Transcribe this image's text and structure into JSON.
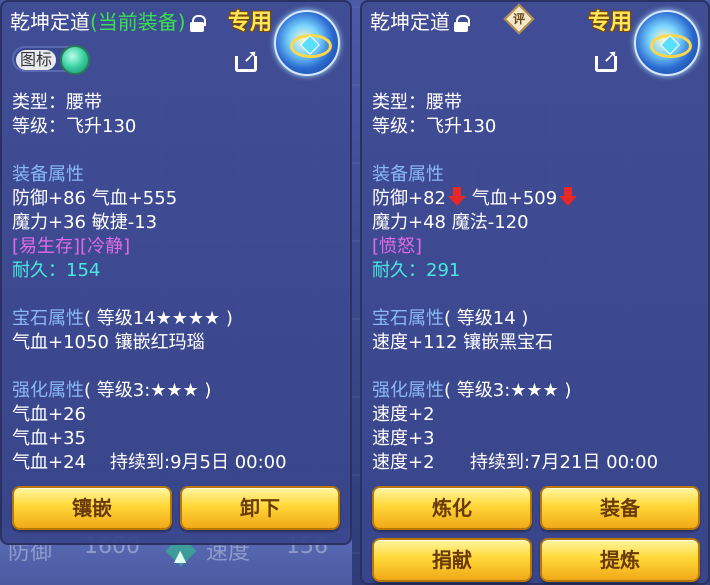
{
  "background": {
    "footer_left_label": "防御",
    "footer_left_value": "1600",
    "footer_right_label": "速度",
    "footer_right_value": "156"
  },
  "left": {
    "title_name": "乾坤定道",
    "title_equipped": "(当前装备)",
    "exclusive": "专用",
    "icon_toggle_label": "图标",
    "type": "类型：腰带",
    "level": "等级：飞升130",
    "attr_header": "装备属性",
    "attr_line1": "防御+86 气血+555",
    "attr_line2": "魔力+36 敏捷-13",
    "special": "[易生存][冷静]",
    "durability_label": "耐久：",
    "durability_value": "154",
    "gem_header": "宝石属性",
    "gem_level": "( 等级14★★★★ )",
    "gem_line": "气血+1050 镶嵌红玛瑙",
    "enhance_header": "强化属性",
    "enhance_level": "( 等级3:★★★ )",
    "enhance_lines": [
      "气血+26",
      "气血+35",
      "气血+24"
    ],
    "duration": "持续到:9月5日 00:00",
    "buttons": [
      "镶嵌",
      "卸下"
    ]
  },
  "right": {
    "title_name": "乾坤定道",
    "review": "评",
    "exclusive": "专用",
    "type": "类型：腰带",
    "level": "等级：飞升130",
    "attr_header": "装备属性",
    "attr_line1_a": "防御+82",
    "attr_line1_b": "气血+509",
    "attr_line2": "魔力+48 魔法-120",
    "special": "[愤怒]",
    "durability_label": "耐久：",
    "durability_value": "291",
    "gem_header": "宝石属性",
    "gem_level": "( 等级14 )",
    "gem_line": "速度+112 镶嵌黑宝石",
    "enhance_header": "强化属性",
    "enhance_level": "( 等级3:★★★ )",
    "enhance_lines": [
      "速度+2",
      "速度+3",
      "速度+2"
    ],
    "duration": "持续到:7月21日 00:00",
    "buttons": [
      "炼化",
      "装备",
      "捐献",
      "提炼"
    ]
  },
  "icons": {
    "lock": "lock-icon",
    "share": "share-icon",
    "down": "down-arrow-icon",
    "belt": "belt-item-icon"
  },
  "colors": {
    "section_header": "#8ab8f8",
    "equipped": "#38e050",
    "special": "#e06ae8",
    "durability": "#4ae8e0",
    "down_arrow": "#e82828",
    "button": "#ffd838"
  }
}
